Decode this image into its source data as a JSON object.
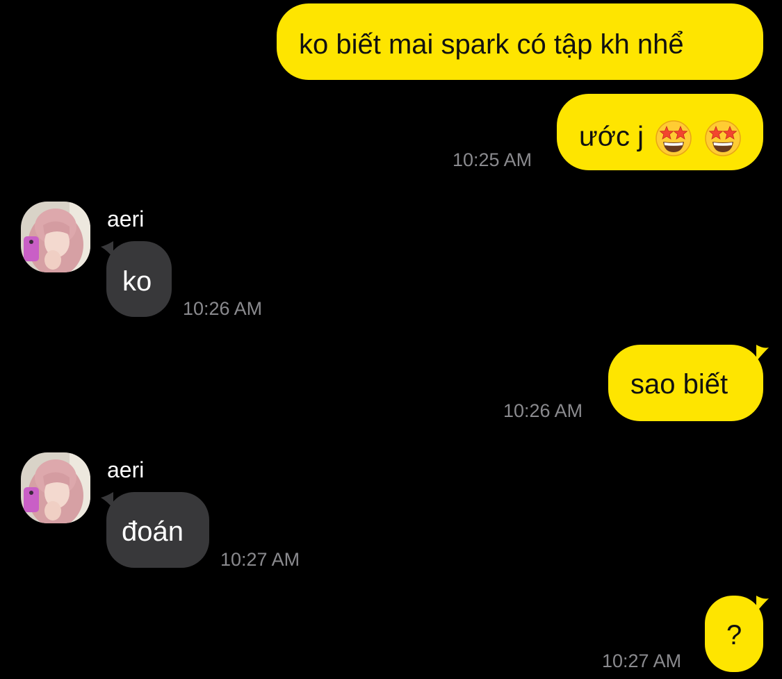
{
  "colors": {
    "background": "#000000",
    "outgoing_bubble": "#FEE500",
    "incoming_bubble": "#38383A",
    "timestamp": "#8A8A8E"
  },
  "messages": [
    {
      "direction": "outgoing",
      "text": "ko biết mai spark có tập kh nhể"
    },
    {
      "direction": "outgoing",
      "text": "ước j",
      "emoji": [
        "star-struck-emoji",
        "star-struck-emoji"
      ],
      "time": "10:25 AM"
    },
    {
      "direction": "incoming",
      "sender": "aeri",
      "avatar": "profile-photo",
      "text": "ko",
      "time": "10:26 AM"
    },
    {
      "direction": "outgoing",
      "text": "sao biết",
      "time": "10:26 AM"
    },
    {
      "direction": "incoming",
      "sender": "aeri",
      "avatar": "profile-photo",
      "text": "đoán",
      "time": "10:27 AM"
    },
    {
      "direction": "outgoing",
      "text": "?",
      "time": "10:27 AM"
    }
  ]
}
